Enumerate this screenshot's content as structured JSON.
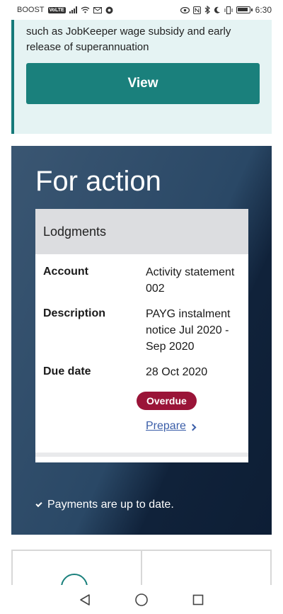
{
  "status_bar": {
    "carrier": "BOOST",
    "volte": "VoLTE",
    "time": "6:30"
  },
  "info_card": {
    "text": "such as JobKeeper wage subsidy and early release of superannuation",
    "button_label": "View"
  },
  "for_action": {
    "title": "For action",
    "card": {
      "heading": "Lodgments",
      "rows": [
        {
          "label": "Account",
          "value": "Activity statement 002"
        },
        {
          "label": "Description",
          "value": "PAYG instalment notice Jul 2020 - Sep 2020"
        },
        {
          "label": "Due date",
          "value": "28 Oct 2020"
        }
      ],
      "status_badge": "Overdue",
      "prepare_link": "Prepare"
    },
    "payments_status": "Payments are up to date."
  },
  "colors": {
    "accent": "#1a807c",
    "overdue": "#9a1438",
    "link": "#3a5da8"
  }
}
